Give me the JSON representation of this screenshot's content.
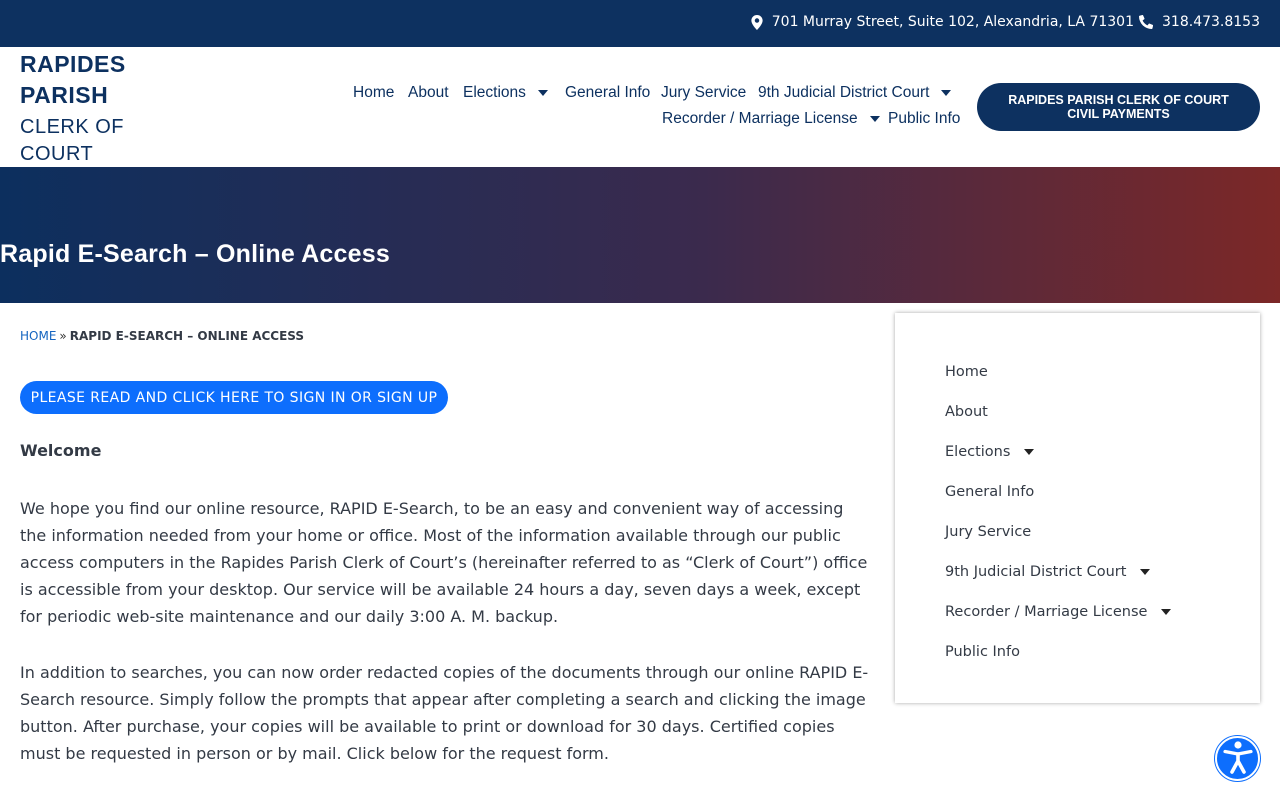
{
  "topbar": {
    "address": "701 Murray Street, Suite 102, Alexandria, LA 71301",
    "phone": "318.473.8153"
  },
  "logo": {
    "line1": "RAPIDES",
    "line2": "PARISH",
    "line3": "CLERK OF",
    "line4": "COURT"
  },
  "nav": {
    "home": "Home",
    "about": "About",
    "elections": "Elections",
    "general_info": "General Info",
    "jury_service": "Jury Service",
    "district_court": "9th Judicial District Court",
    "recorder": "Recorder / Marriage License",
    "public_info": "Public Info"
  },
  "pay_button": "Rapides Parish Clerk of Court Civil Payments",
  "hero": {
    "title": "Rapid E-Search – Online Access"
  },
  "breadcrumb": {
    "home": "Home",
    "sep": "»",
    "current": "Rapid E-Search – Online Access"
  },
  "signin_button": "Please read and click here to sign in or sign up",
  "content": {
    "welcome": "Welcome",
    "p1": "We hope you find our online resource, RAPID E-Search, to be an easy and convenient way of accessing the information needed from your home or office. Most of the information available through our public access computers in the Rapides Parish Clerk of Court’s (hereinafter referred to as “Clerk of Court”) office is accessible from your desktop. Our service will be available 24 hours a day, seven days a week, except for periodic web-site maintenance and our daily 3:00 A. M. backup.",
    "p2": "In addition to searches, you can now order redacted copies of the documents through our online RAPID E-Search resource. Simply follow the prompts that appear after completing a search and clicking the image button. After purchase, your copies will be available to print or download for 30 days. Certified copies must be requested in person or by mail. Click below for the request form."
  },
  "sidebar": {
    "items": [
      {
        "label": "Home"
      },
      {
        "label": "About"
      },
      {
        "label": "Elections"
      },
      {
        "label": "General Info"
      },
      {
        "label": "Jury Service"
      },
      {
        "label": "9th Judicial District Court"
      },
      {
        "label": "Recorder / Marriage License"
      },
      {
        "label": "Public Info"
      }
    ]
  },
  "icons": {
    "address": "map-pin-icon",
    "phone": "phone-icon",
    "accessibility": "accessibility-icon"
  },
  "colors": {
    "brand_navy": "#0d3160",
    "accent_blue": "#0d6efd",
    "hero_red": "#7c2827"
  }
}
